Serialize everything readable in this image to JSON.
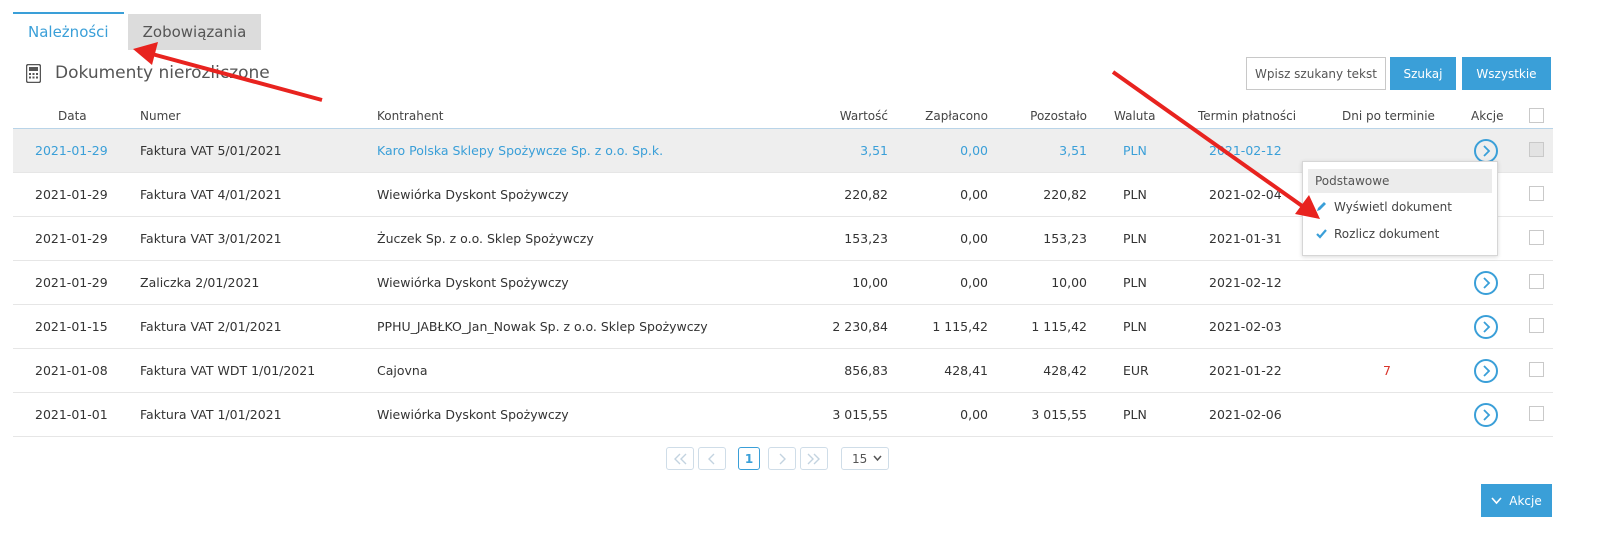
{
  "tabs": [
    {
      "label": "Należności",
      "active": true
    },
    {
      "label": "Zobowiązania",
      "active": false
    }
  ],
  "heading": {
    "title": "Dokumenty nierozliczone",
    "icon": "calculator-icon"
  },
  "search": {
    "placeholder": "Wpisz szukany tekst",
    "button_label": "Szukaj",
    "all_label": "Wszystkie"
  },
  "table": {
    "columns": [
      "Data",
      "Numer",
      "Kontrahent",
      "Wartość",
      "Zapłacono",
      "Pozostało",
      "Waluta",
      "Termin płatności",
      "Dni po terminie",
      "Akcje"
    ],
    "rows": [
      {
        "data": "2021-01-29",
        "numer": "Faktura VAT 5/01/2021",
        "kontrahent": "Karo Polska Sklepy Spożywcze Sp. z o.o. Sp.k.",
        "wartosc": "3,51",
        "zaplacono": "0,00",
        "pozostalo": "3,51",
        "waluta": "PLN",
        "termin": "2021-02-12",
        "dni": "",
        "selected": true
      },
      {
        "data": "2021-01-29",
        "numer": "Faktura VAT 4/01/2021",
        "kontrahent": "Wiewiórka Dyskont Spożywczy",
        "wartosc": "220,82",
        "zaplacono": "0,00",
        "pozostalo": "220,82",
        "waluta": "PLN",
        "termin": "2021-02-04",
        "dni": ""
      },
      {
        "data": "2021-01-29",
        "numer": "Faktura VAT 3/01/2021",
        "kontrahent": "Żuczek Sp. z o.o. Sklep Spożywczy",
        "wartosc": "153,23",
        "zaplacono": "0,00",
        "pozostalo": "153,23",
        "waluta": "PLN",
        "termin": "2021-01-31",
        "dni": ""
      },
      {
        "data": "2021-01-29",
        "numer": "Zaliczka 2/01/2021",
        "kontrahent": "Wiewiórka Dyskont Spożywczy",
        "wartosc": "10,00",
        "zaplacono": "0,00",
        "pozostalo": "10,00",
        "waluta": "PLN",
        "termin": "2021-02-12",
        "dni": ""
      },
      {
        "data": "2021-01-15",
        "numer": "Faktura VAT 2/01/2021",
        "kontrahent": "PPHU_JABŁKO_Jan_Nowak Sp. z o.o. Sklep Spożywczy",
        "wartosc": "2 230,84",
        "zaplacono": "1 115,42",
        "pozostalo": "1 115,42",
        "waluta": "PLN",
        "termin": "2021-02-03",
        "dni": ""
      },
      {
        "data": "2021-01-08",
        "numer": "Faktura VAT WDT 1/01/2021",
        "kontrahent": "Cajovna",
        "wartosc": "856,83",
        "zaplacono": "428,41",
        "pozostalo": "428,42",
        "waluta": "EUR",
        "termin": "2021-01-22",
        "dni": "7"
      },
      {
        "data": "2021-01-01",
        "numer": "Faktura VAT 1/01/2021",
        "kontrahent": "Wiewiórka Dyskont Spożywczy",
        "wartosc": "3 015,55",
        "zaplacono": "0,00",
        "pozostalo": "3 015,55",
        "waluta": "PLN",
        "termin": "2021-02-06",
        "dni": ""
      }
    ]
  },
  "dropdown": {
    "header": "Podstawowe",
    "items": [
      {
        "label": "Wyświetl dokument",
        "icon": "pencil-icon"
      },
      {
        "label": "Rozlicz dokument",
        "icon": "checkmark-icon"
      }
    ]
  },
  "pagination": {
    "current": "1",
    "page_size": "15"
  },
  "footer": {
    "actions_label": "Akcje"
  },
  "colors": {
    "accent": "#3a9fd8",
    "overdue": "#d9342b",
    "annotation": "#e8231f"
  }
}
